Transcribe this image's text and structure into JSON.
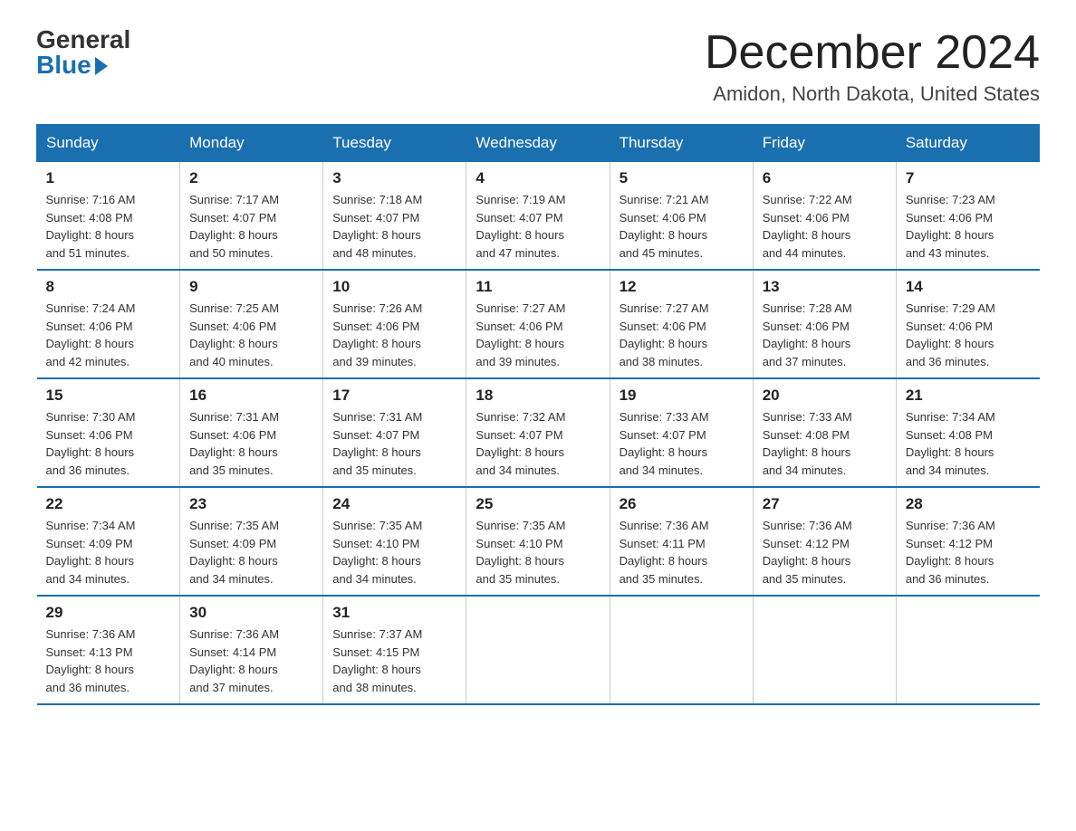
{
  "logo": {
    "general": "General",
    "blue": "Blue"
  },
  "title": "December 2024",
  "location": "Amidon, North Dakota, United States",
  "weekdays": [
    "Sunday",
    "Monday",
    "Tuesday",
    "Wednesday",
    "Thursday",
    "Friday",
    "Saturday"
  ],
  "weeks": [
    [
      {
        "day": "1",
        "sunrise": "7:16 AM",
        "sunset": "4:08 PM",
        "daylight": "8 hours and 51 minutes."
      },
      {
        "day": "2",
        "sunrise": "7:17 AM",
        "sunset": "4:07 PM",
        "daylight": "8 hours and 50 minutes."
      },
      {
        "day": "3",
        "sunrise": "7:18 AM",
        "sunset": "4:07 PM",
        "daylight": "8 hours and 48 minutes."
      },
      {
        "day": "4",
        "sunrise": "7:19 AM",
        "sunset": "4:07 PM",
        "daylight": "8 hours and 47 minutes."
      },
      {
        "day": "5",
        "sunrise": "7:21 AM",
        "sunset": "4:06 PM",
        "daylight": "8 hours and 45 minutes."
      },
      {
        "day": "6",
        "sunrise": "7:22 AM",
        "sunset": "4:06 PM",
        "daylight": "8 hours and 44 minutes."
      },
      {
        "day": "7",
        "sunrise": "7:23 AM",
        "sunset": "4:06 PM",
        "daylight": "8 hours and 43 minutes."
      }
    ],
    [
      {
        "day": "8",
        "sunrise": "7:24 AM",
        "sunset": "4:06 PM",
        "daylight": "8 hours and 42 minutes."
      },
      {
        "day": "9",
        "sunrise": "7:25 AM",
        "sunset": "4:06 PM",
        "daylight": "8 hours and 40 minutes."
      },
      {
        "day": "10",
        "sunrise": "7:26 AM",
        "sunset": "4:06 PM",
        "daylight": "8 hours and 39 minutes."
      },
      {
        "day": "11",
        "sunrise": "7:27 AM",
        "sunset": "4:06 PM",
        "daylight": "8 hours and 39 minutes."
      },
      {
        "day": "12",
        "sunrise": "7:27 AM",
        "sunset": "4:06 PM",
        "daylight": "8 hours and 38 minutes."
      },
      {
        "day": "13",
        "sunrise": "7:28 AM",
        "sunset": "4:06 PM",
        "daylight": "8 hours and 37 minutes."
      },
      {
        "day": "14",
        "sunrise": "7:29 AM",
        "sunset": "4:06 PM",
        "daylight": "8 hours and 36 minutes."
      }
    ],
    [
      {
        "day": "15",
        "sunrise": "7:30 AM",
        "sunset": "4:06 PM",
        "daylight": "8 hours and 36 minutes."
      },
      {
        "day": "16",
        "sunrise": "7:31 AM",
        "sunset": "4:06 PM",
        "daylight": "8 hours and 35 minutes."
      },
      {
        "day": "17",
        "sunrise": "7:31 AM",
        "sunset": "4:07 PM",
        "daylight": "8 hours and 35 minutes."
      },
      {
        "day": "18",
        "sunrise": "7:32 AM",
        "sunset": "4:07 PM",
        "daylight": "8 hours and 34 minutes."
      },
      {
        "day": "19",
        "sunrise": "7:33 AM",
        "sunset": "4:07 PM",
        "daylight": "8 hours and 34 minutes."
      },
      {
        "day": "20",
        "sunrise": "7:33 AM",
        "sunset": "4:08 PM",
        "daylight": "8 hours and 34 minutes."
      },
      {
        "day": "21",
        "sunrise": "7:34 AM",
        "sunset": "4:08 PM",
        "daylight": "8 hours and 34 minutes."
      }
    ],
    [
      {
        "day": "22",
        "sunrise": "7:34 AM",
        "sunset": "4:09 PM",
        "daylight": "8 hours and 34 minutes."
      },
      {
        "day": "23",
        "sunrise": "7:35 AM",
        "sunset": "4:09 PM",
        "daylight": "8 hours and 34 minutes."
      },
      {
        "day": "24",
        "sunrise": "7:35 AM",
        "sunset": "4:10 PM",
        "daylight": "8 hours and 34 minutes."
      },
      {
        "day": "25",
        "sunrise": "7:35 AM",
        "sunset": "4:10 PM",
        "daylight": "8 hours and 35 minutes."
      },
      {
        "day": "26",
        "sunrise": "7:36 AM",
        "sunset": "4:11 PM",
        "daylight": "8 hours and 35 minutes."
      },
      {
        "day": "27",
        "sunrise": "7:36 AM",
        "sunset": "4:12 PM",
        "daylight": "8 hours and 35 minutes."
      },
      {
        "day": "28",
        "sunrise": "7:36 AM",
        "sunset": "4:12 PM",
        "daylight": "8 hours and 36 minutes."
      }
    ],
    [
      {
        "day": "29",
        "sunrise": "7:36 AM",
        "sunset": "4:13 PM",
        "daylight": "8 hours and 36 minutes."
      },
      {
        "day": "30",
        "sunrise": "7:36 AM",
        "sunset": "4:14 PM",
        "daylight": "8 hours and 37 minutes."
      },
      {
        "day": "31",
        "sunrise": "7:37 AM",
        "sunset": "4:15 PM",
        "daylight": "8 hours and 38 minutes."
      },
      null,
      null,
      null,
      null
    ]
  ],
  "labels": {
    "sunrise": "Sunrise:",
    "sunset": "Sunset:",
    "daylight": "Daylight:"
  }
}
